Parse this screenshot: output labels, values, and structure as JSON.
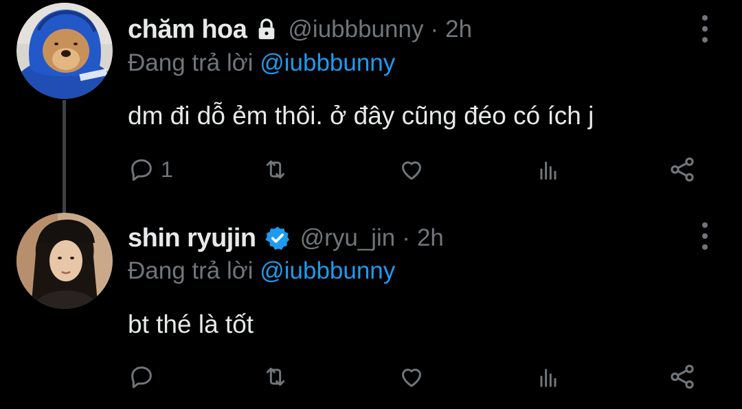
{
  "tweets": [
    {
      "display_name": "chăm hoa",
      "badge": "lock-icon",
      "handle": "@iubbbunny",
      "separator": "·",
      "time": "2h",
      "reply_prefix": "Đang trả lời",
      "reply_to": "@iubbbunny",
      "text": "dm đi dỗ ẻm thôi. ở đây cũng đéo có ích j",
      "reply_count": "1",
      "avatar": "avatar-dog-in-blue-hoodie"
    },
    {
      "display_name": "shin ryujin",
      "badge": "verified-icon",
      "handle": "@ryu_jin",
      "separator": "·",
      "time": "2h",
      "reply_prefix": "Đang trả lời",
      "reply_to": "@iubbbunny",
      "text": "bt thé là tốt",
      "reply_count": "",
      "avatar": "avatar-person-black-cap"
    }
  ],
  "colors": {
    "background": "#000000",
    "primary_text": "#e7e9ea",
    "secondary_text": "#71767b",
    "accent": "#1d9bf0",
    "thread_line": "#3e4144"
  },
  "icons": {
    "reply": "reply-icon",
    "retweet": "retweet-icon",
    "like": "heart-icon",
    "views": "views-icon",
    "share": "share-icon",
    "more": "more-vertical-icon"
  }
}
